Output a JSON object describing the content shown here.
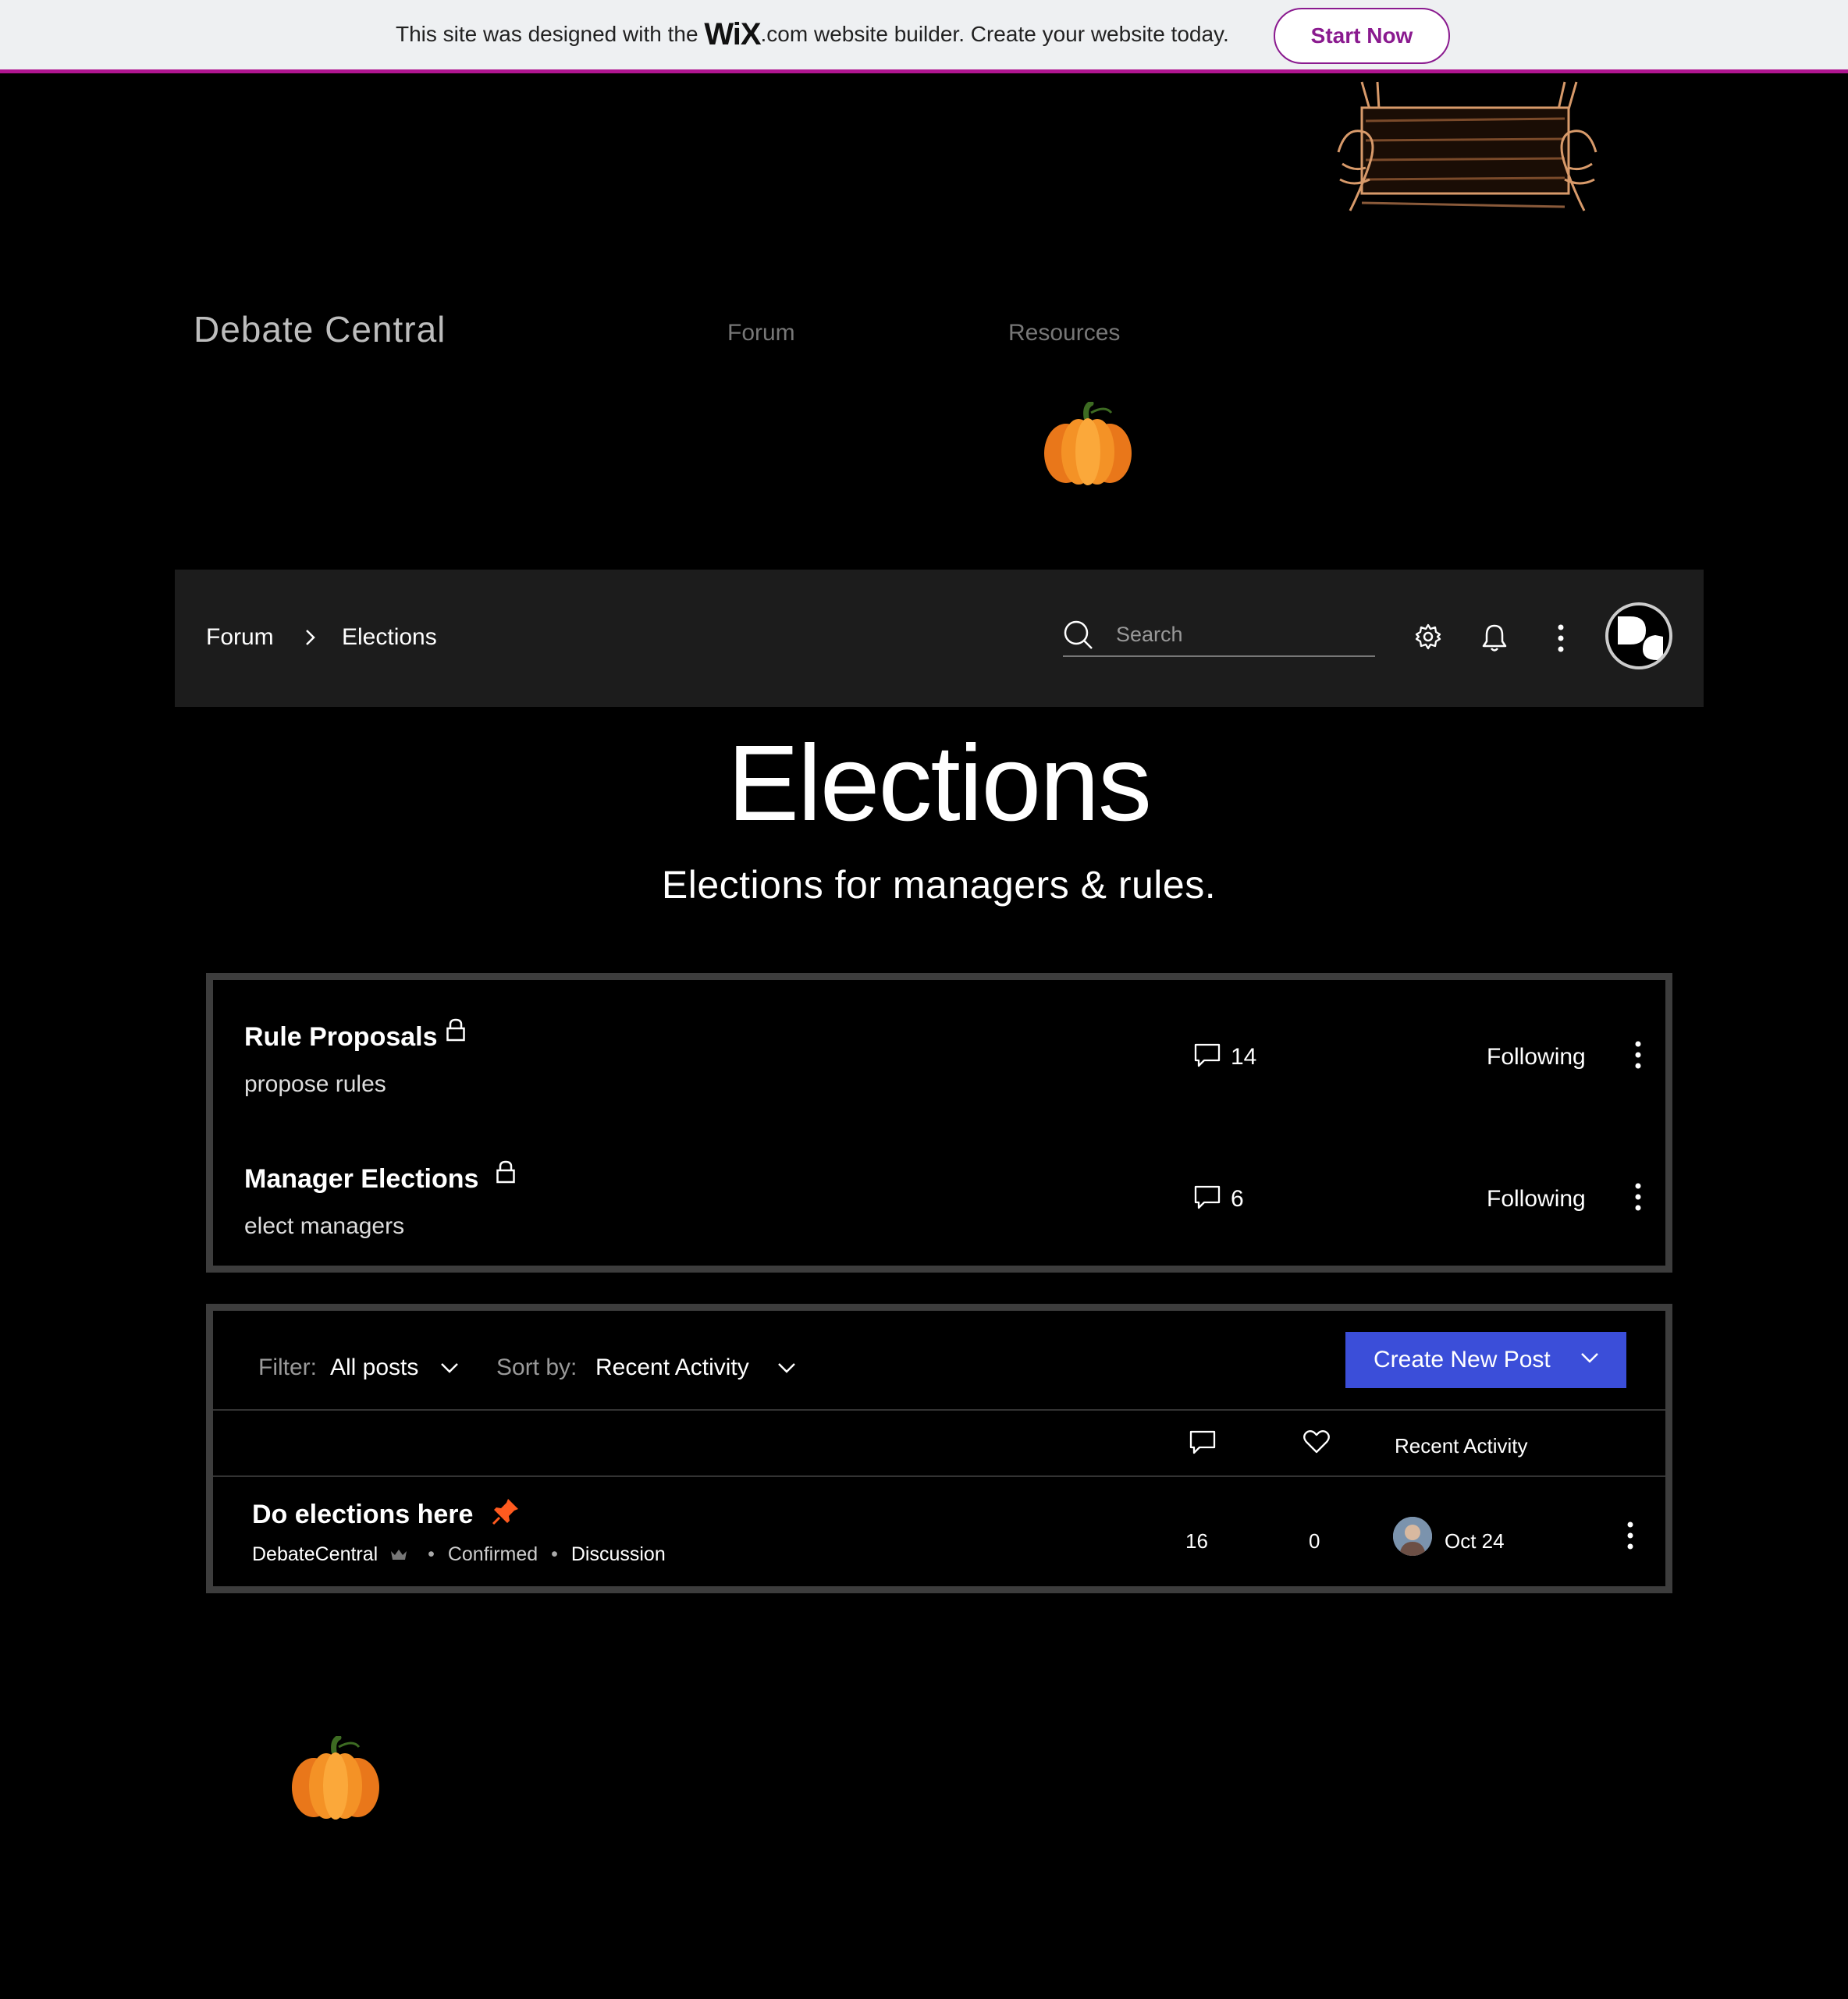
{
  "banner": {
    "text_before": "This site was designed with the",
    "brand": "WiX",
    "text_after": ".com website builder. Create your website today.",
    "button": "Start Now"
  },
  "site": {
    "title": "Debate Central",
    "nav": [
      "Forum",
      "Resources"
    ]
  },
  "forum_bar": {
    "breadcrumb": [
      "Forum",
      "Elections"
    ],
    "search_placeholder": "Search"
  },
  "page": {
    "title": "Elections",
    "subtitle": "Elections for managers & rules."
  },
  "categories": [
    {
      "title": "Rule Proposals",
      "description": "propose rules",
      "comments": "14",
      "follow": "Following"
    },
    {
      "title": "Manager Elections",
      "description": "elect managers",
      "comments": "6",
      "follow": "Following"
    }
  ],
  "posts": {
    "filter_label": "Filter:",
    "filter_value": "All posts",
    "sort_label": "Sort by:",
    "sort_value": "Recent Activity",
    "create_button": "Create New Post",
    "col_recent": "Recent Activity",
    "items": [
      {
        "title": "Do elections here",
        "author": "DebateCentral",
        "status": "Confirmed",
        "type": "Discussion",
        "comments": "16",
        "likes": "0",
        "date": "Oct 24"
      }
    ]
  },
  "colors": {
    "accent": "#3b4ed9",
    "banner_accent": "#b01590",
    "pin": "#ff5a1f"
  }
}
